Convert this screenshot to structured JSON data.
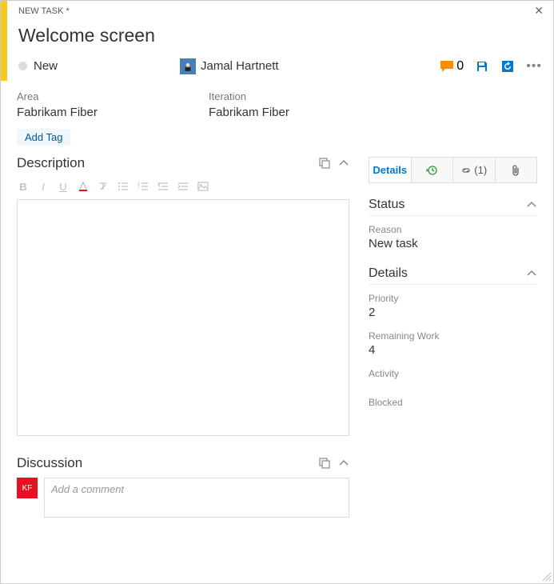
{
  "header": {
    "type_label": "NEW TASK *"
  },
  "title": "Welcome screen",
  "state": {
    "label": "New"
  },
  "assignee": {
    "name": "Jamal Hartnett"
  },
  "comments": {
    "count": "0"
  },
  "fields": {
    "area": {
      "label": "Area",
      "value": "Fabrikam Fiber"
    },
    "iteration": {
      "label": "Iteration",
      "value": "Fabrikam Fiber"
    }
  },
  "add_tag_label": "Add Tag",
  "sections": {
    "description": "Description",
    "discussion": "Discussion"
  },
  "discussion": {
    "avatar_initials": "KF",
    "placeholder": "Add a comment"
  },
  "tabs": {
    "details": "Details",
    "links": "(1)"
  },
  "status_panel": {
    "title": "Status",
    "reason": {
      "label": "Reason",
      "value": "New task"
    }
  },
  "details_panel": {
    "title": "Details",
    "priority": {
      "label": "Priority",
      "value": "2"
    },
    "remaining": {
      "label": "Remaining Work",
      "value": "4"
    },
    "activity": {
      "label": "Activity"
    },
    "blocked": {
      "label": "Blocked"
    }
  }
}
